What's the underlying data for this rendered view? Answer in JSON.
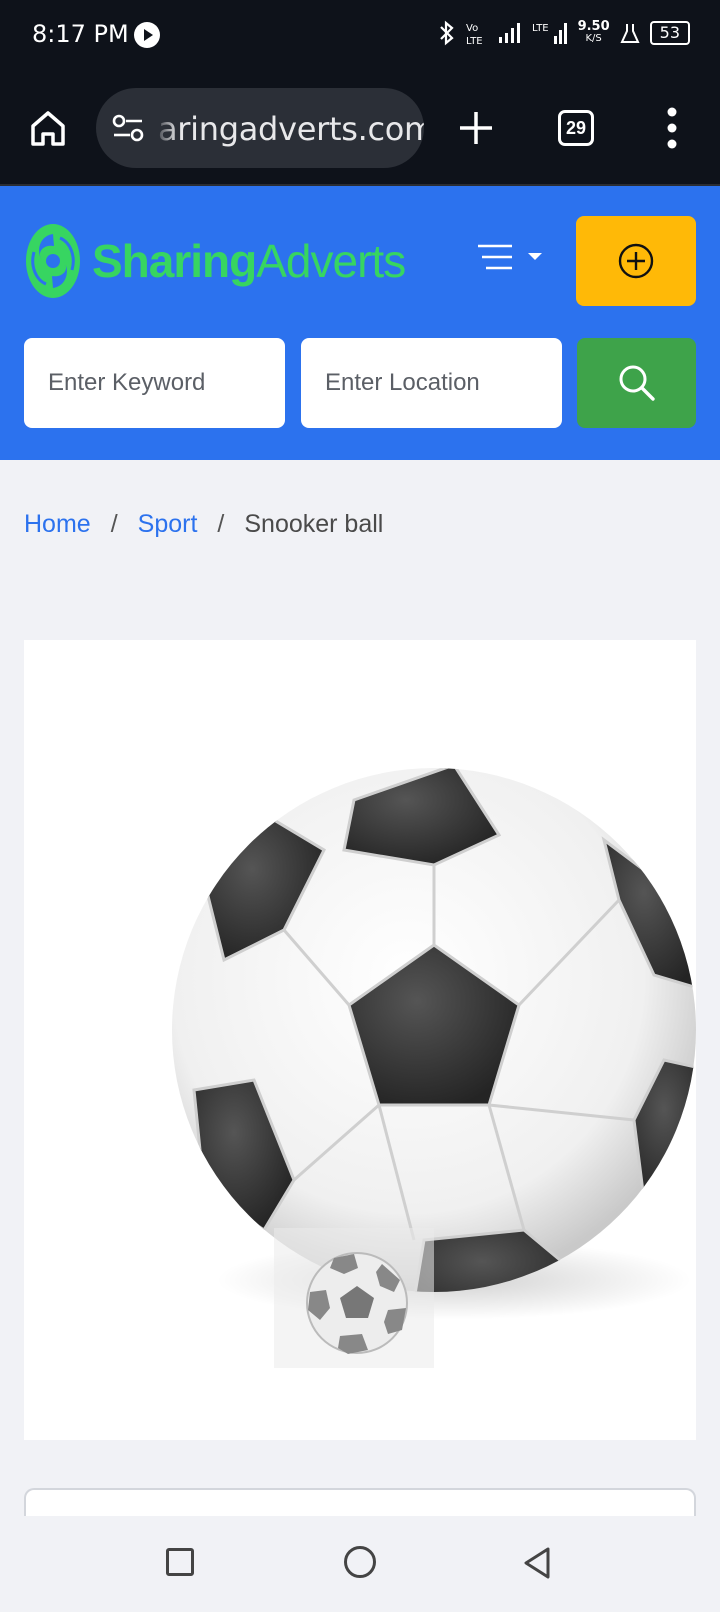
{
  "status": {
    "time": "8:17 PM",
    "net_speed_value": "9.50",
    "net_speed_unit": "K/S",
    "battery": "53"
  },
  "browser": {
    "url": "aringadverts.com",
    "tab_count": "29"
  },
  "header": {
    "logo_primary": "Sharing",
    "logo_secondary": "Adverts",
    "brand_color": "#2c72ee",
    "post_ad_color": "#ffb907",
    "search_button_color": "#3ea34a"
  },
  "search": {
    "keyword_placeholder": "Enter Keyword",
    "location_placeholder": "Enter Location"
  },
  "breadcrumb": {
    "home": "Home",
    "category": "Sport",
    "current": "Snooker ball",
    "separator": "/"
  },
  "icons": {
    "home": "home-icon",
    "site_settings": "site-settings-icon",
    "new_tab": "plus-icon",
    "menu": "more-vert-icon",
    "nav_toggle": "menu-lines-icon",
    "post_ad": "plus-circle-icon",
    "search": "search-icon"
  }
}
